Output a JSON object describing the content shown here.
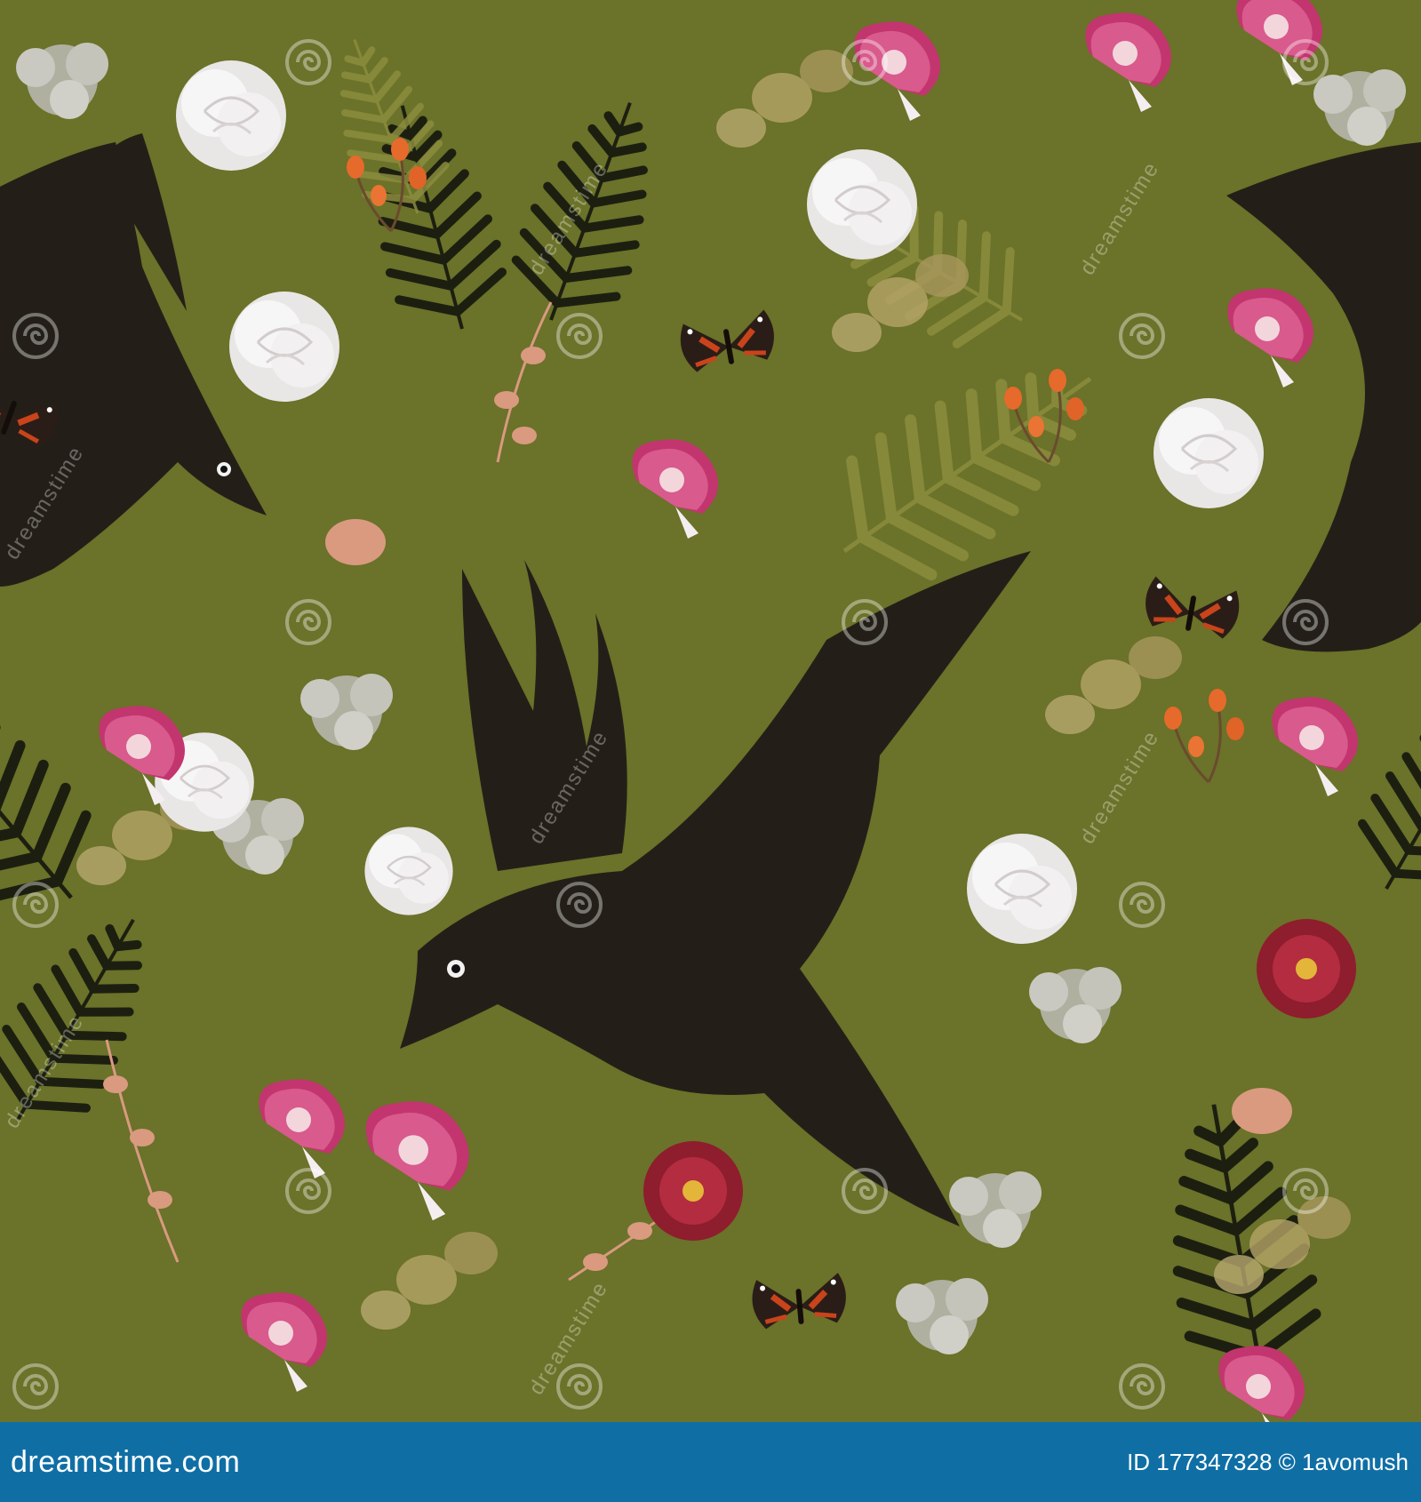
{
  "artwork": {
    "background_color": "#6b7229",
    "elements": [
      "raven",
      "white-rose",
      "pink-morning-glory",
      "red-admiral-butterfly",
      "fern",
      "rosehip-berries",
      "yarrow",
      "red-aster",
      "eucalyptus"
    ],
    "watermark_text": "dreamstime"
  },
  "footer": {
    "background_color": "#0f6fa5",
    "site": "dreamstime.com",
    "id_text": "ID 177347328 © 1avomush"
  }
}
